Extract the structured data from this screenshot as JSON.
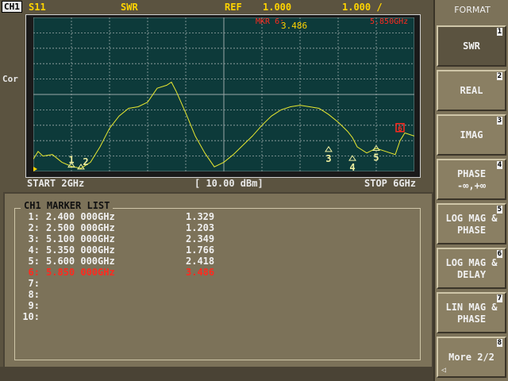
{
  "header": {
    "channel": "CH1",
    "param": "S11",
    "format": "SWR",
    "ref_label": "REF",
    "ref_value": "1.000",
    "scale_value": "1.000 /",
    "marker_readout_label": "MKR 6:",
    "marker_readout_freq": "5.850GHz",
    "marker_readout_value": "3.486"
  },
  "side_label": "Cor",
  "footer": {
    "start": "START 2GHz",
    "power": "[ 10.00 dBm]",
    "stop": "STOP 6GHz"
  },
  "marker_list": {
    "title": "CH1 MARKER LIST",
    "rows": [
      {
        "idx": "1:",
        "freq": "2.400 000GHz",
        "val": "1.329",
        "active": false
      },
      {
        "idx": "2:",
        "freq": "2.500 000GHz",
        "val": "1.203",
        "active": false
      },
      {
        "idx": "3:",
        "freq": "5.100 000GHz",
        "val": "2.349",
        "active": false
      },
      {
        "idx": "4:",
        "freq": "5.350 000GHz",
        "val": "1.766",
        "active": false
      },
      {
        "idx": "5:",
        "freq": "5.600 000GHz",
        "val": "2.418",
        "active": false
      },
      {
        "idx": "6:",
        "freq": "5.850 000GHz",
        "val": "3.486",
        "active": true
      },
      {
        "idx": "7:",
        "freq": "",
        "val": "",
        "active": false
      },
      {
        "idx": "8:",
        "freq": "",
        "val": "",
        "active": false
      },
      {
        "idx": "9:",
        "freq": "",
        "val": "",
        "active": false
      },
      {
        "idx": "10:",
        "freq": "",
        "val": "",
        "active": false
      }
    ]
  },
  "menu": {
    "title": "FORMAT",
    "keys": [
      {
        "num": "1",
        "line1": "SWR",
        "line2": "",
        "selected": true
      },
      {
        "num": "2",
        "line1": "REAL",
        "line2": "",
        "selected": false
      },
      {
        "num": "3",
        "line1": "IMAG",
        "line2": "",
        "selected": false
      },
      {
        "num": "4",
        "line1": "PHASE",
        "line2": "-∞,+∞",
        "selected": false
      },
      {
        "num": "5",
        "line1": "LOG MAG &",
        "line2": "PHASE",
        "selected": false
      },
      {
        "num": "6",
        "line1": "LOG MAG &",
        "line2": "DELAY",
        "selected": false
      },
      {
        "num": "7",
        "line1": "LIN MAG &",
        "line2": "PHASE",
        "selected": false
      },
      {
        "num": "8",
        "line1": "More 2/2",
        "line2": "",
        "selected": false
      }
    ],
    "more_glyph": "◁"
  },
  "colors": {
    "trace": "#e8e830",
    "grid": "#9aa8a8",
    "active_marker": "#ff2a1f"
  },
  "chart_data": {
    "type": "line",
    "title": "",
    "xlabel": "",
    "ylabel": "",
    "x_start_ghz": 2.0,
    "x_stop_ghz": 6.0,
    "x_divisions": 10,
    "y_divisions": 10,
    "ref_value": 1.0,
    "scale_per_div": 1.0,
    "series": [
      {
        "x": [
          2.0,
          2.05,
          2.1,
          2.2,
          2.3,
          2.4,
          2.5,
          2.6,
          2.7,
          2.8,
          2.9,
          3.0,
          3.1,
          3.2,
          3.3,
          3.4,
          3.45,
          3.5,
          3.6,
          3.7,
          3.8,
          3.9,
          4.0,
          4.1,
          4.2,
          4.3,
          4.4,
          4.5,
          4.6,
          4.7,
          4.8,
          4.9,
          5.0,
          5.1,
          5.2,
          5.3,
          5.35,
          5.4,
          5.5,
          5.6,
          5.7,
          5.8,
          5.85,
          5.9,
          6.0
        ],
        "y": [
          1.8,
          2.3,
          2.0,
          2.1,
          1.6,
          1.33,
          1.2,
          1.6,
          2.6,
          3.8,
          4.6,
          5.1,
          5.2,
          5.5,
          6.4,
          6.6,
          6.8,
          6.2,
          4.8,
          3.3,
          2.2,
          1.3,
          1.6,
          2.1,
          2.7,
          3.3,
          4.0,
          4.6,
          5.0,
          5.2,
          5.3,
          5.2,
          5.1,
          4.7,
          4.2,
          3.6,
          3.2,
          2.6,
          2.2,
          2.5,
          2.3,
          2.1,
          3.0,
          3.5,
          3.3
        ]
      }
    ],
    "markers": [
      {
        "label": "1",
        "x": 2.4,
        "y": 1.329
      },
      {
        "label": "2",
        "x": 2.5,
        "y": 1.203
      },
      {
        "label": "3",
        "x": 5.1,
        "y": 2.349
      },
      {
        "label": "4",
        "x": 5.35,
        "y": 1.766
      },
      {
        "label": "5",
        "x": 5.6,
        "y": 2.418
      },
      {
        "label": "6",
        "x": 5.85,
        "y": 3.486
      }
    ]
  }
}
